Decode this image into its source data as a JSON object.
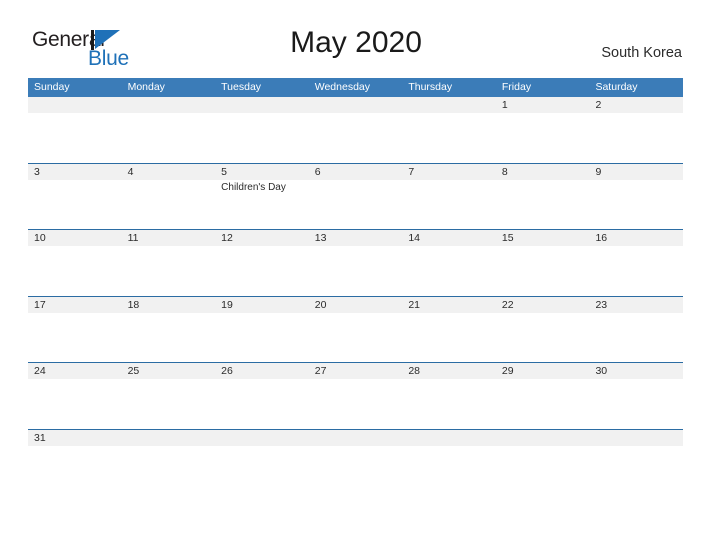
{
  "brand": {
    "line1": "General",
    "line2": "Blue",
    "mark": "flag-triangle",
    "color_dark": "#231f20",
    "color_blue": "#1f71b8"
  },
  "header": {
    "title": "May 2020",
    "region": "South Korea"
  },
  "theme": {
    "header_blue": "#3b7cb8",
    "rule_blue": "#2b6ca3",
    "band_gray": "#f1f1f1",
    "text": "#2b2b2b"
  },
  "calendar": {
    "weekdays": [
      "Sunday",
      "Monday",
      "Tuesday",
      "Wednesday",
      "Thursday",
      "Friday",
      "Saturday"
    ],
    "weeks": [
      [
        {
          "day": "",
          "event": ""
        },
        {
          "day": "",
          "event": ""
        },
        {
          "day": "",
          "event": ""
        },
        {
          "day": "",
          "event": ""
        },
        {
          "day": "",
          "event": ""
        },
        {
          "day": "1",
          "event": ""
        },
        {
          "day": "2",
          "event": ""
        }
      ],
      [
        {
          "day": "3",
          "event": ""
        },
        {
          "day": "4",
          "event": ""
        },
        {
          "day": "5",
          "event": "Children's Day"
        },
        {
          "day": "6",
          "event": ""
        },
        {
          "day": "7",
          "event": ""
        },
        {
          "day": "8",
          "event": ""
        },
        {
          "day": "9",
          "event": ""
        }
      ],
      [
        {
          "day": "10",
          "event": ""
        },
        {
          "day": "11",
          "event": ""
        },
        {
          "day": "12",
          "event": ""
        },
        {
          "day": "13",
          "event": ""
        },
        {
          "day": "14",
          "event": ""
        },
        {
          "day": "15",
          "event": ""
        },
        {
          "day": "16",
          "event": ""
        }
      ],
      [
        {
          "day": "17",
          "event": ""
        },
        {
          "day": "18",
          "event": ""
        },
        {
          "day": "19",
          "event": ""
        },
        {
          "day": "20",
          "event": ""
        },
        {
          "day": "21",
          "event": ""
        },
        {
          "day": "22",
          "event": ""
        },
        {
          "day": "23",
          "event": ""
        }
      ],
      [
        {
          "day": "24",
          "event": ""
        },
        {
          "day": "25",
          "event": ""
        },
        {
          "day": "26",
          "event": ""
        },
        {
          "day": "27",
          "event": ""
        },
        {
          "day": "28",
          "event": ""
        },
        {
          "day": "29",
          "event": ""
        },
        {
          "day": "30",
          "event": ""
        }
      ],
      [
        {
          "day": "31",
          "event": ""
        },
        {
          "day": "",
          "event": ""
        },
        {
          "day": "",
          "event": ""
        },
        {
          "day": "",
          "event": ""
        },
        {
          "day": "",
          "event": ""
        },
        {
          "day": "",
          "event": ""
        },
        {
          "day": "",
          "event": ""
        }
      ]
    ]
  }
}
